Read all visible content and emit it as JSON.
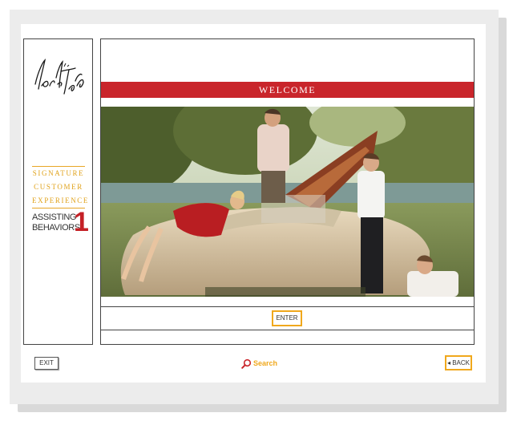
{
  "brand": {
    "logo_text": "Lord & Taylor"
  },
  "sidebar": {
    "program_lines": [
      "SIGNATURE",
      "CUSTOMER",
      "EXPERIENCE"
    ],
    "module_title_line1": "ASSISTING",
    "module_title_line2": "BEHAVIORS",
    "module_number": "1"
  },
  "main": {
    "banner_title": "WELCOME",
    "enter_label": "ENTER"
  },
  "footer": {
    "exit_label": "EXIT",
    "search_label": "Search",
    "back_label": "◂ BACK"
  },
  "colors": {
    "accent": "#f0a81c",
    "brand_red": "#c9252b"
  },
  "icons": {
    "search": "magnifier-icon",
    "back": "left-arrow-icon"
  }
}
